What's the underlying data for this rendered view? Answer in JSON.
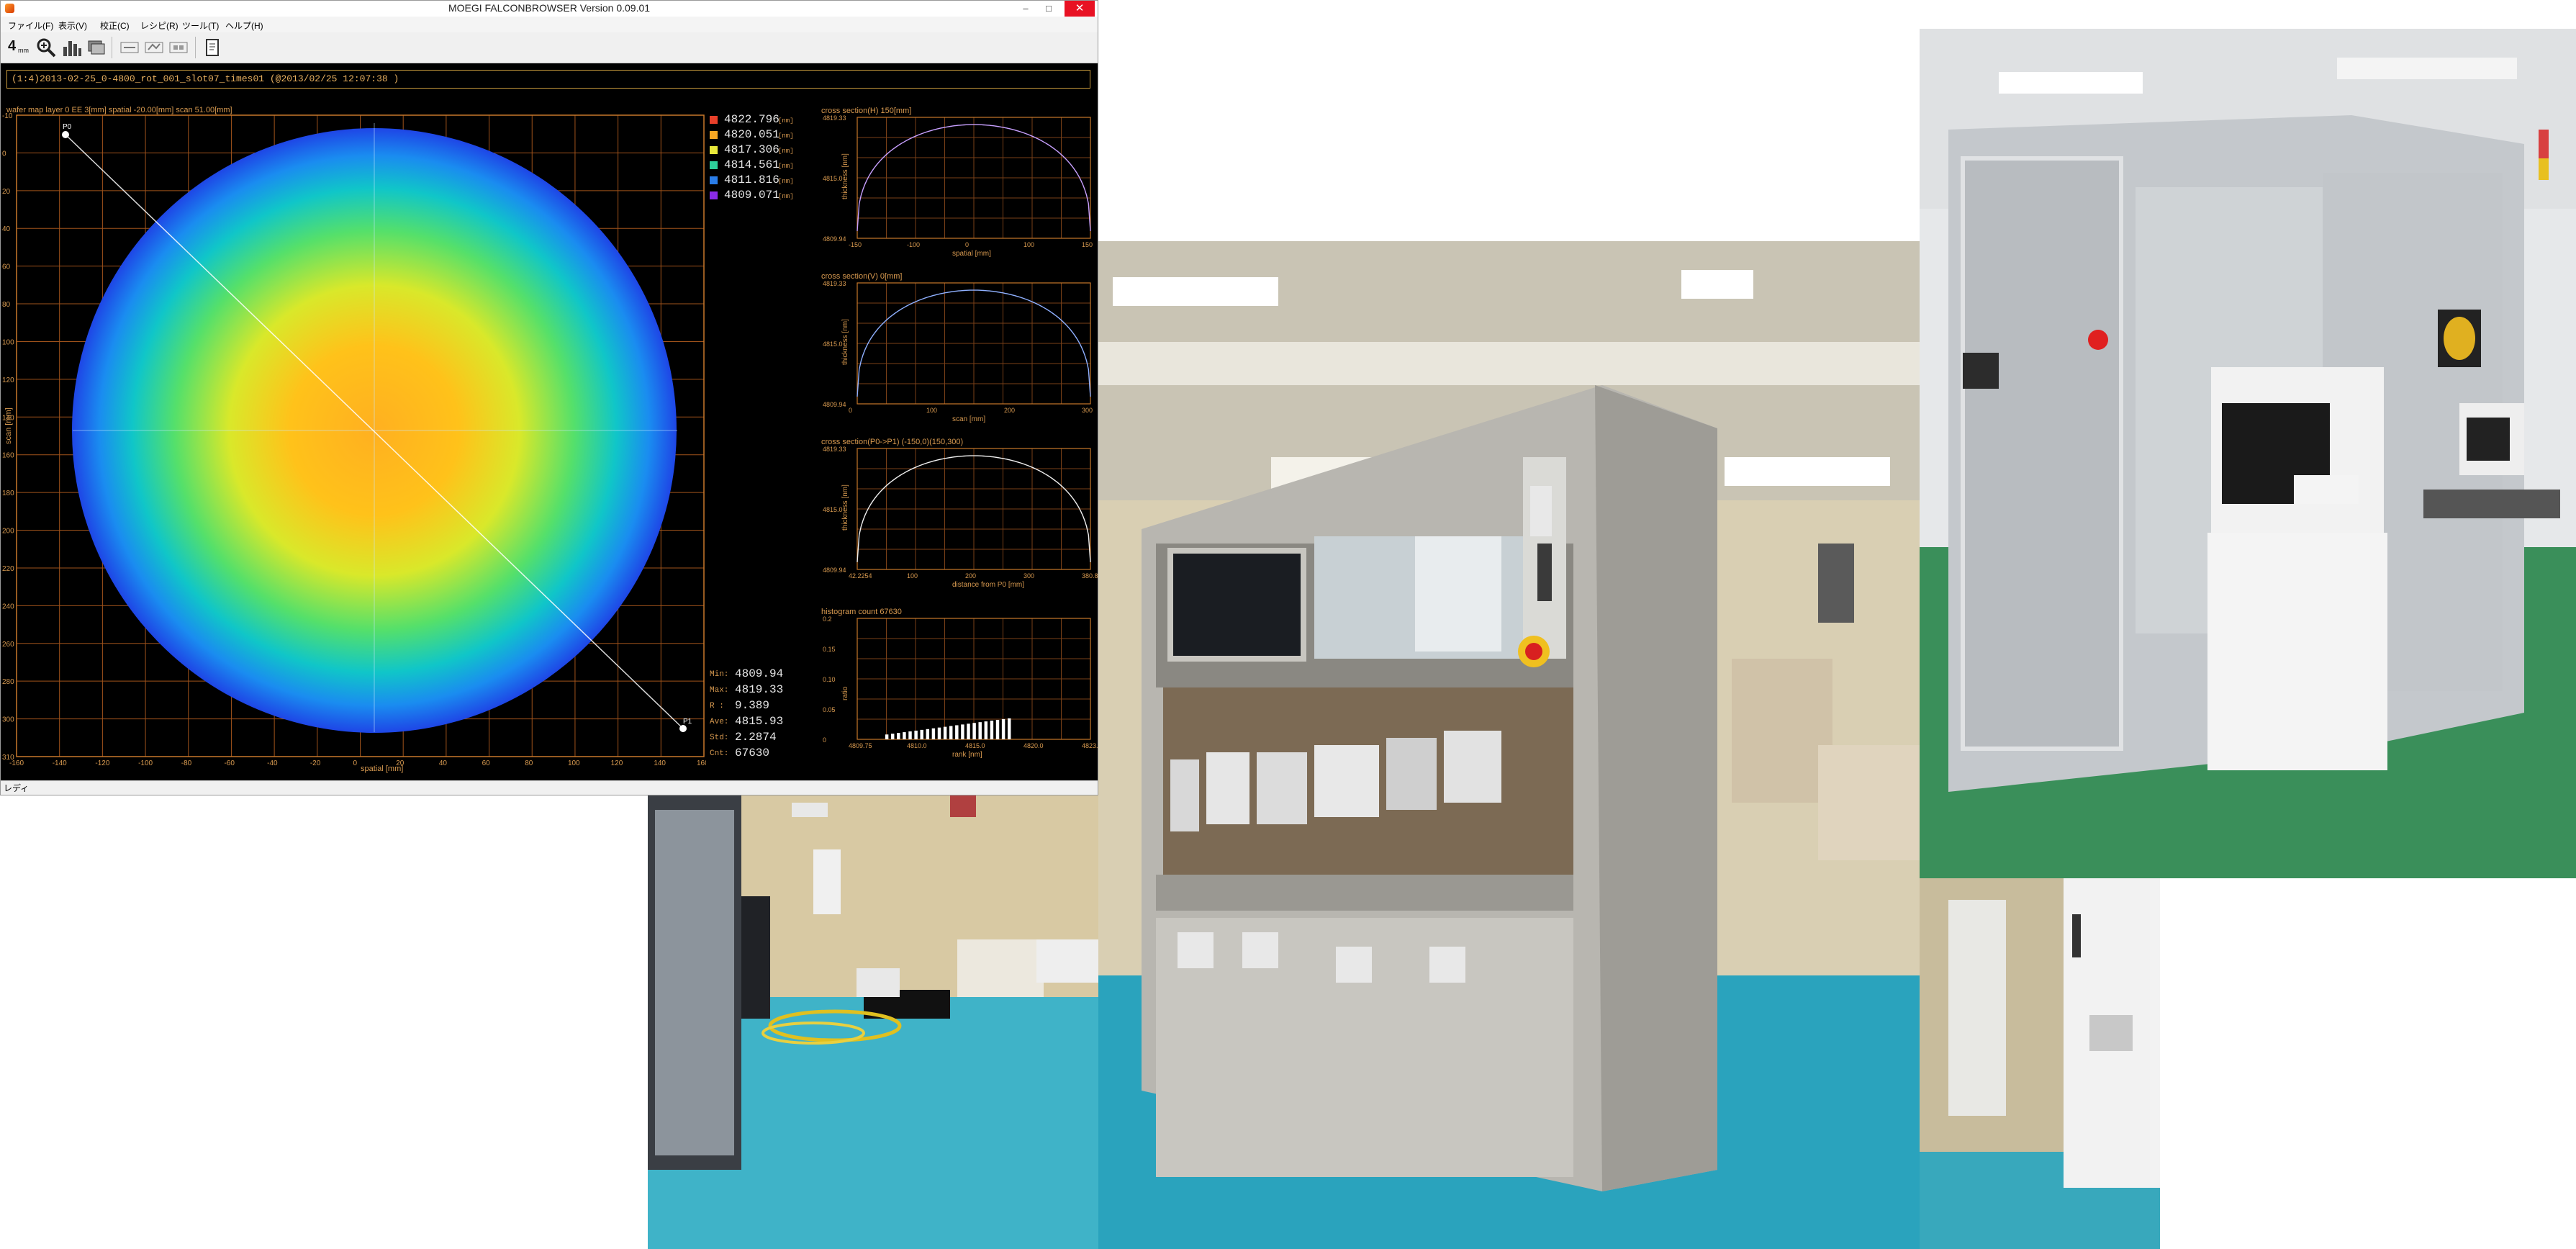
{
  "window": {
    "title": "MOEGI FALCONBROWSER Version 0.09.01",
    "controls": {
      "minimize": "–",
      "maximize": "□",
      "close": "✕"
    }
  },
  "menu": [
    "ファイル(F)",
    "表示(V)",
    "校正(C)",
    "レシピ(R)",
    "ツール(T)",
    "ヘルプ(H)"
  ],
  "toolbar": {
    "first_label": "4",
    "first_sub": "mm",
    "icons": [
      "zoom-icon",
      "bar-chart-icon",
      "layers-icon",
      "filter-icon-1",
      "filter-icon-2",
      "filter-icon-3",
      "export-icon"
    ]
  },
  "path": "(1:4)2013-02-25_0-4800_rot_001_slot07_times01 (@2013/02/25 12:07:38 )",
  "wafer_map": {
    "info": "wafer map  layer 0  EE 3[mm]  spatial  -20.00[mm] scan  51.00[mm]",
    "xlabel": "spatial [mm]",
    "ylabel": "scan [mm]",
    "xticks": [
      "-160",
      "-140",
      "-120",
      "-100",
      "-80",
      "-60",
      "-40",
      "-20",
      "0",
      "20",
      "40",
      "60",
      "80",
      "100",
      "120",
      "140",
      "160"
    ],
    "yticks": [
      "-10",
      "0",
      "20",
      "40",
      "60",
      "80",
      "100",
      "120",
      "140",
      "160",
      "180",
      "200",
      "220",
      "240",
      "260",
      "280",
      "300",
      "310"
    ],
    "p0_label": "P0",
    "p1_label": "P1",
    "colors": {
      "gridline": "#a0531b",
      "frame": "#c8782a",
      "axis_text": "#d89a50"
    }
  },
  "legend": {
    "unit": "[nm]",
    "items": [
      {
        "value": "4822.796",
        "color": "#e8402a"
      },
      {
        "value": "4820.051",
        "color": "#f5a623"
      },
      {
        "value": "4817.306",
        "color": "#e8e83a"
      },
      {
        "value": "4814.561",
        "color": "#2ecf9a"
      },
      {
        "value": "4811.816",
        "color": "#2a7de8"
      },
      {
        "value": "4809.071",
        "color": "#8a2be8"
      }
    ]
  },
  "stats": [
    {
      "label": "Min:",
      "value": "4809.94"
    },
    {
      "label": "Max:",
      "value": "4819.33"
    },
    {
      "label": "R  :",
      "value": "9.389"
    },
    {
      "label": "Ave:",
      "value": "4815.93"
    },
    {
      "label": "Std:",
      "value": "2.2874"
    },
    {
      "label": "Cnt:",
      "value": "67630"
    }
  ],
  "charts": [
    {
      "title": "cross section(H) 150[mm]",
      "ylabel": "thickness [nm]",
      "xlabel": "spatial [mm]",
      "yticks": [
        "4819.33",
        "4815.0",
        "4809.94"
      ],
      "xticks": [
        "-150",
        "-100",
        "0",
        "100",
        "150"
      ],
      "line_color": "#c8a0ff"
    },
    {
      "title": "cross section(V) 0[mm]",
      "ylabel": "thickness [nm]",
      "xlabel": "scan [mm]",
      "yticks": [
        "4819.33",
        "4815.0",
        "4809.94"
      ],
      "xticks": [
        "0",
        "100",
        "200",
        "300"
      ],
      "line_color": "#8fb0ff"
    },
    {
      "title": "cross section(P0->P1) (-150,0)(150,300)",
      "ylabel": "thickness [nm]",
      "xlabel": "distance from P0 [mm]",
      "yticks": [
        "4819.33",
        "4815.0",
        "4809.94"
      ],
      "xticks": [
        "42.2254",
        "100",
        "200",
        "300",
        "380.826"
      ],
      "line_color": "#f0f0f0"
    },
    {
      "title": "histogram  count 67630",
      "ylabel": "ratio",
      "xlabel": "rank [nm]",
      "yticks": [
        "0.2",
        "0.15",
        "0.10",
        "0.05",
        "0"
      ],
      "xticks": [
        "4809.75",
        "4810.0",
        "4815.0",
        "4820.0",
        "4823.16"
      ],
      "line_color": "#ffffff"
    }
  ],
  "statusbar": {
    "text": "レディ"
  }
}
